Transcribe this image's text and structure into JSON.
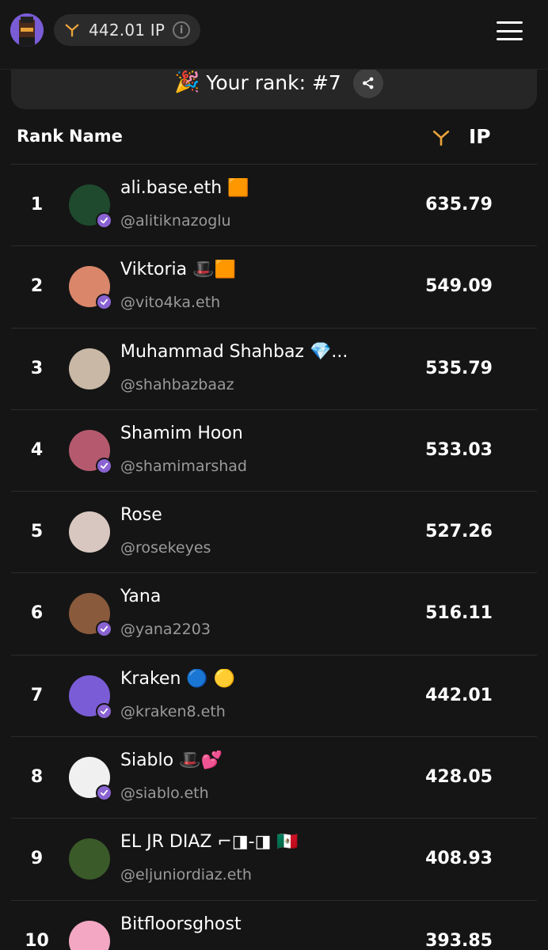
{
  "header": {
    "balance": "442.01 IP",
    "info_glyph": "i",
    "currency_icon": "y-icon",
    "menu_icon": "hamburger-menu-icon"
  },
  "rank_card": {
    "party_emoji": "🎉",
    "text": "Your rank: #7",
    "share_icon": "share-icon"
  },
  "table": {
    "col_rank": "Rank",
    "col_name": "Name",
    "col_ip": "IP"
  },
  "colors": {
    "accent_yellow": "#e9a33b",
    "verified_purple": "#8a63d2",
    "background": "#151515"
  },
  "rows": [
    {
      "rank": "1",
      "name": "ali.base.eth 🟧",
      "handle": "@alitiknazoglu",
      "ip": "635.79",
      "verified": true,
      "avatar_color": "#1f4a2e"
    },
    {
      "rank": "2",
      "name": "Viktoria 🎩🟧",
      "handle": "@vito4ka.eth",
      "ip": "549.09",
      "verified": true,
      "avatar_color": "#d9866a"
    },
    {
      "rank": "3",
      "name": "Muhammad Shahbaz 💎...",
      "handle": "@shahbazbaaz",
      "ip": "535.79",
      "verified": false,
      "avatar_color": "#c9b8a6"
    },
    {
      "rank": "4",
      "name": "Shamim Hoon",
      "handle": "@shamimarshad",
      "ip": "533.03",
      "verified": true,
      "avatar_color": "#b55a6e"
    },
    {
      "rank": "5",
      "name": "Rose",
      "handle": "@rosekeyes",
      "ip": "527.26",
      "verified": false,
      "avatar_color": "#d8c7c0"
    },
    {
      "rank": "6",
      "name": "Yana",
      "handle": "@yana2203",
      "ip": "516.11",
      "verified": true,
      "avatar_color": "#8a5a3c"
    },
    {
      "rank": "7",
      "name": "Kraken 🔵 🟡",
      "handle": "@kraken8.eth",
      "ip": "442.01",
      "verified": true,
      "avatar_color": "#7a5cd6"
    },
    {
      "rank": "8",
      "name": "Siablo 🎩💕",
      "handle": "@siablo.eth",
      "ip": "428.05",
      "verified": true,
      "avatar_color": "#f0f0f0"
    },
    {
      "rank": "9",
      "name": "EL JR DIAZ ⌐◨-◨ 🇲🇽",
      "handle": "@eljuniordiaz.eth",
      "ip": "408.93",
      "verified": false,
      "avatar_color": "#3a5a2a"
    },
    {
      "rank": "10",
      "name": "Bitfloorsghost",
      "handle": "",
      "ip": "393.85",
      "verified": false,
      "avatar_color": "#f3a7c2"
    }
  ]
}
